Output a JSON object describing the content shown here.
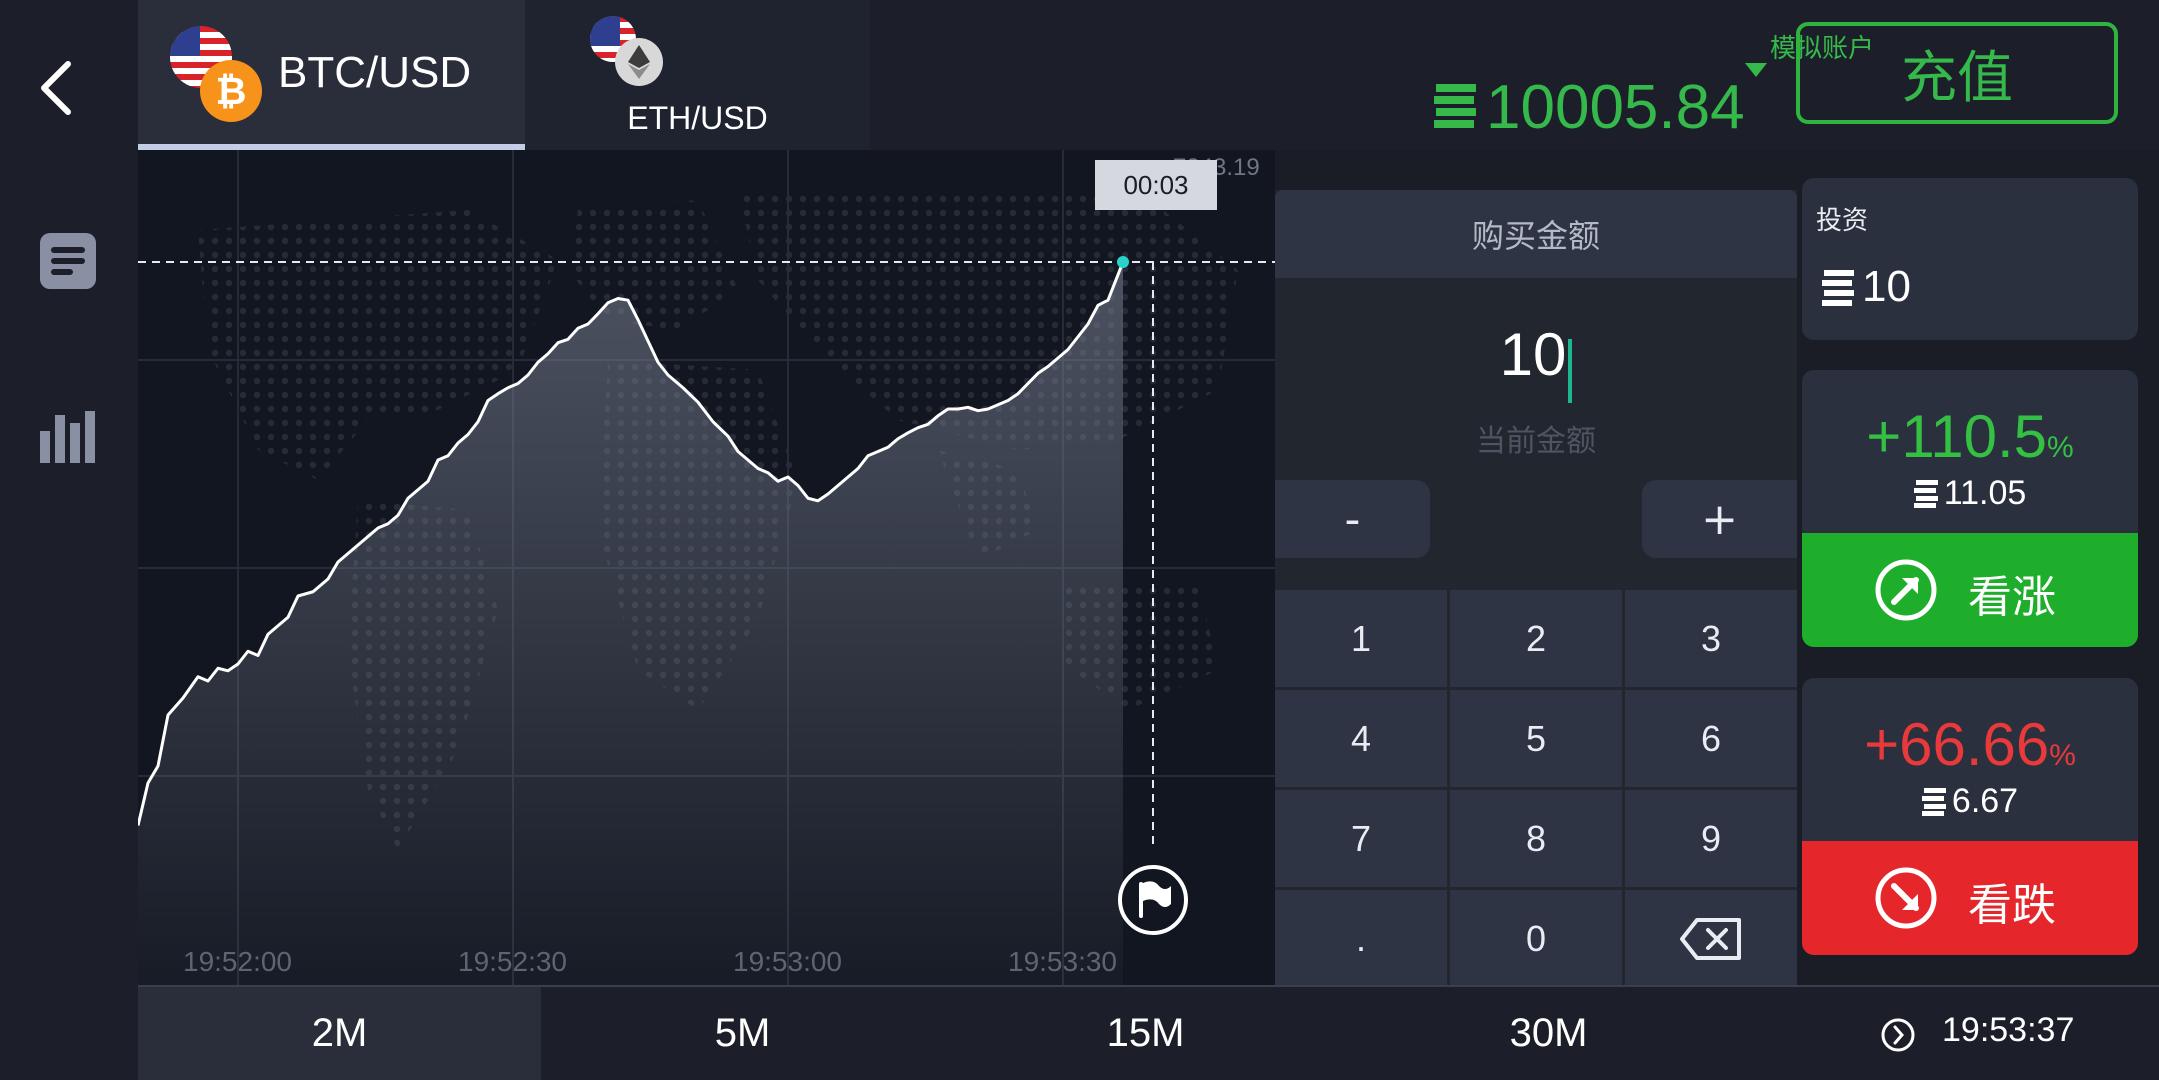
{
  "nav": {
    "back_icon": "chevron-left-icon",
    "icons": [
      "document-list-icon",
      "bar-chart-icon"
    ]
  },
  "tabs": [
    {
      "label": "BTC/USD",
      "active": true
    },
    {
      "label": "ETH/USD",
      "active": false
    }
  ],
  "account": {
    "type_label": "模拟账户",
    "balance": "10005.84",
    "deposit_label": "充值"
  },
  "chart": {
    "price_label": "7843.19",
    "timer": "00:03",
    "time_labels": [
      "19:52:00",
      "19:52:30",
      "19:53:00",
      "19:53:30"
    ],
    "line_color": "#ffffff",
    "point_color": "#29d3c8"
  },
  "amount_panel": {
    "header": "购买金额",
    "value": "10",
    "sub_label": "当前金额",
    "minus": "-",
    "plus": "+",
    "keys": [
      "1",
      "2",
      "3",
      "4",
      "5",
      "6",
      "7",
      "8",
      "9",
      ".",
      "0"
    ]
  },
  "invest": {
    "label": "投资",
    "amount": "10"
  },
  "call": {
    "percent": "+110.5",
    "percent_unit": "%",
    "payout": "11.05",
    "button": "看涨",
    "color": "#1fae2c"
  },
  "put": {
    "percent": "+66.66",
    "percent_unit": "%",
    "payout": "6.67",
    "button": "看跌",
    "color": "#e5262a"
  },
  "timeframes": [
    "2M",
    "5M",
    "15M",
    "30M"
  ],
  "clock": "19:53:37"
}
